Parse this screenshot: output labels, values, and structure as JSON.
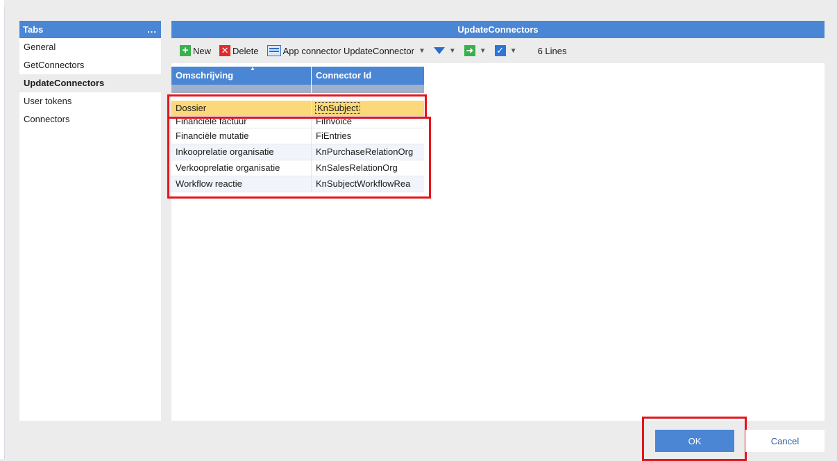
{
  "tabs": {
    "title": "Tabs",
    "more": "...",
    "items": [
      {
        "label": "General"
      },
      {
        "label": "GetConnectors"
      },
      {
        "label": "UpdateConnectors"
      },
      {
        "label": "User tokens"
      },
      {
        "label": "Connectors"
      }
    ]
  },
  "main": {
    "title": "UpdateConnectors",
    "toolbar": {
      "new_label": "New",
      "delete_label": "Delete",
      "app_connector_label": "App connector UpdateConnector",
      "lines": "6 Lines"
    },
    "grid": {
      "columns": [
        "Omschrijving",
        "Connector Id"
      ],
      "rows": [
        {
          "omschrijving": "Dossier",
          "connector_id": "KnSubject"
        },
        {
          "omschrijving": "Financiële factuur",
          "connector_id": "FiInvoice"
        },
        {
          "omschrijving": "Financiële mutatie",
          "connector_id": "FiEntries"
        },
        {
          "omschrijving": "Inkooprelatie organisatie",
          "connector_id": "KnPurchaseRelationOrg"
        },
        {
          "omschrijving": "Verkooprelatie organisatie",
          "connector_id": "KnSalesRelationOrg"
        },
        {
          "omschrijving": "Workflow reactie",
          "connector_id": "KnSubjectWorkflowRea"
        }
      ]
    }
  },
  "buttons": {
    "ok": "OK",
    "cancel": "Cancel"
  },
  "colors": {
    "header_blue": "#4a86d4",
    "highlight_red": "#e4141b",
    "selected_row": "#fbd879"
  }
}
